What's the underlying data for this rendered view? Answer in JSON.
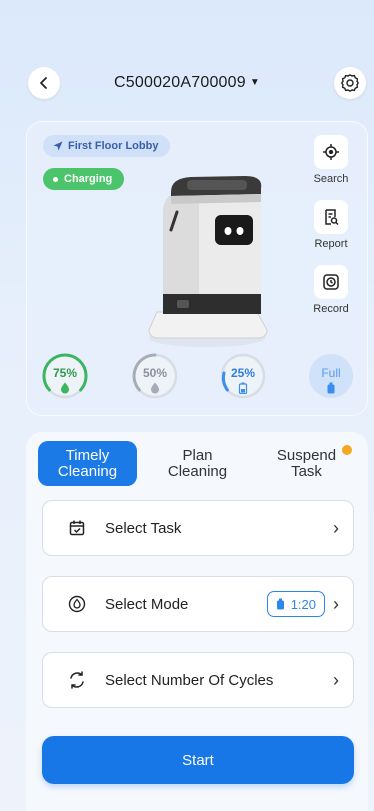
{
  "header": {
    "device_id": "C500020A700009",
    "back_icon": "chevron-left-icon",
    "settings_icon": "gear-icon"
  },
  "robot": {
    "location": "First Floor Lobby",
    "status": "Charging",
    "status_color": "#4cc46c",
    "actions": [
      {
        "label": "Search",
        "icon": "crosshair-icon"
      },
      {
        "label": "Report",
        "icon": "report-icon"
      },
      {
        "label": "Record",
        "icon": "clock-record-icon"
      }
    ],
    "gauges": [
      {
        "label": "75%",
        "value": 0.75,
        "color": "#3bb55f",
        "icon": "water-drop-icon"
      },
      {
        "label": "50%",
        "value": 0.5,
        "color": "#a6adb8",
        "icon": "water-drop-icon"
      },
      {
        "label": "25%",
        "value": 0.25,
        "color": "#3a8ef0",
        "icon": "battery-icon"
      },
      {
        "label": "Full",
        "value": 1.0,
        "color": "#3a8ef0",
        "icon": "tank-icon"
      }
    ]
  },
  "tabs": [
    {
      "line1": "Timely",
      "line2": "Cleaning",
      "active": true
    },
    {
      "line1": "Plan",
      "line2": "Cleaning",
      "active": false
    },
    {
      "line1": "Suspend",
      "line2": "Task",
      "active": false,
      "badge": true
    }
  ],
  "options": {
    "select_task": "Select Task",
    "select_mode": "Select Mode",
    "mode_ratio": "1:20",
    "select_cycles": "Select Number Of Cycles"
  },
  "start_label": "Start",
  "colors": {
    "accent": "#1877e6",
    "badge": "#f5a623"
  }
}
